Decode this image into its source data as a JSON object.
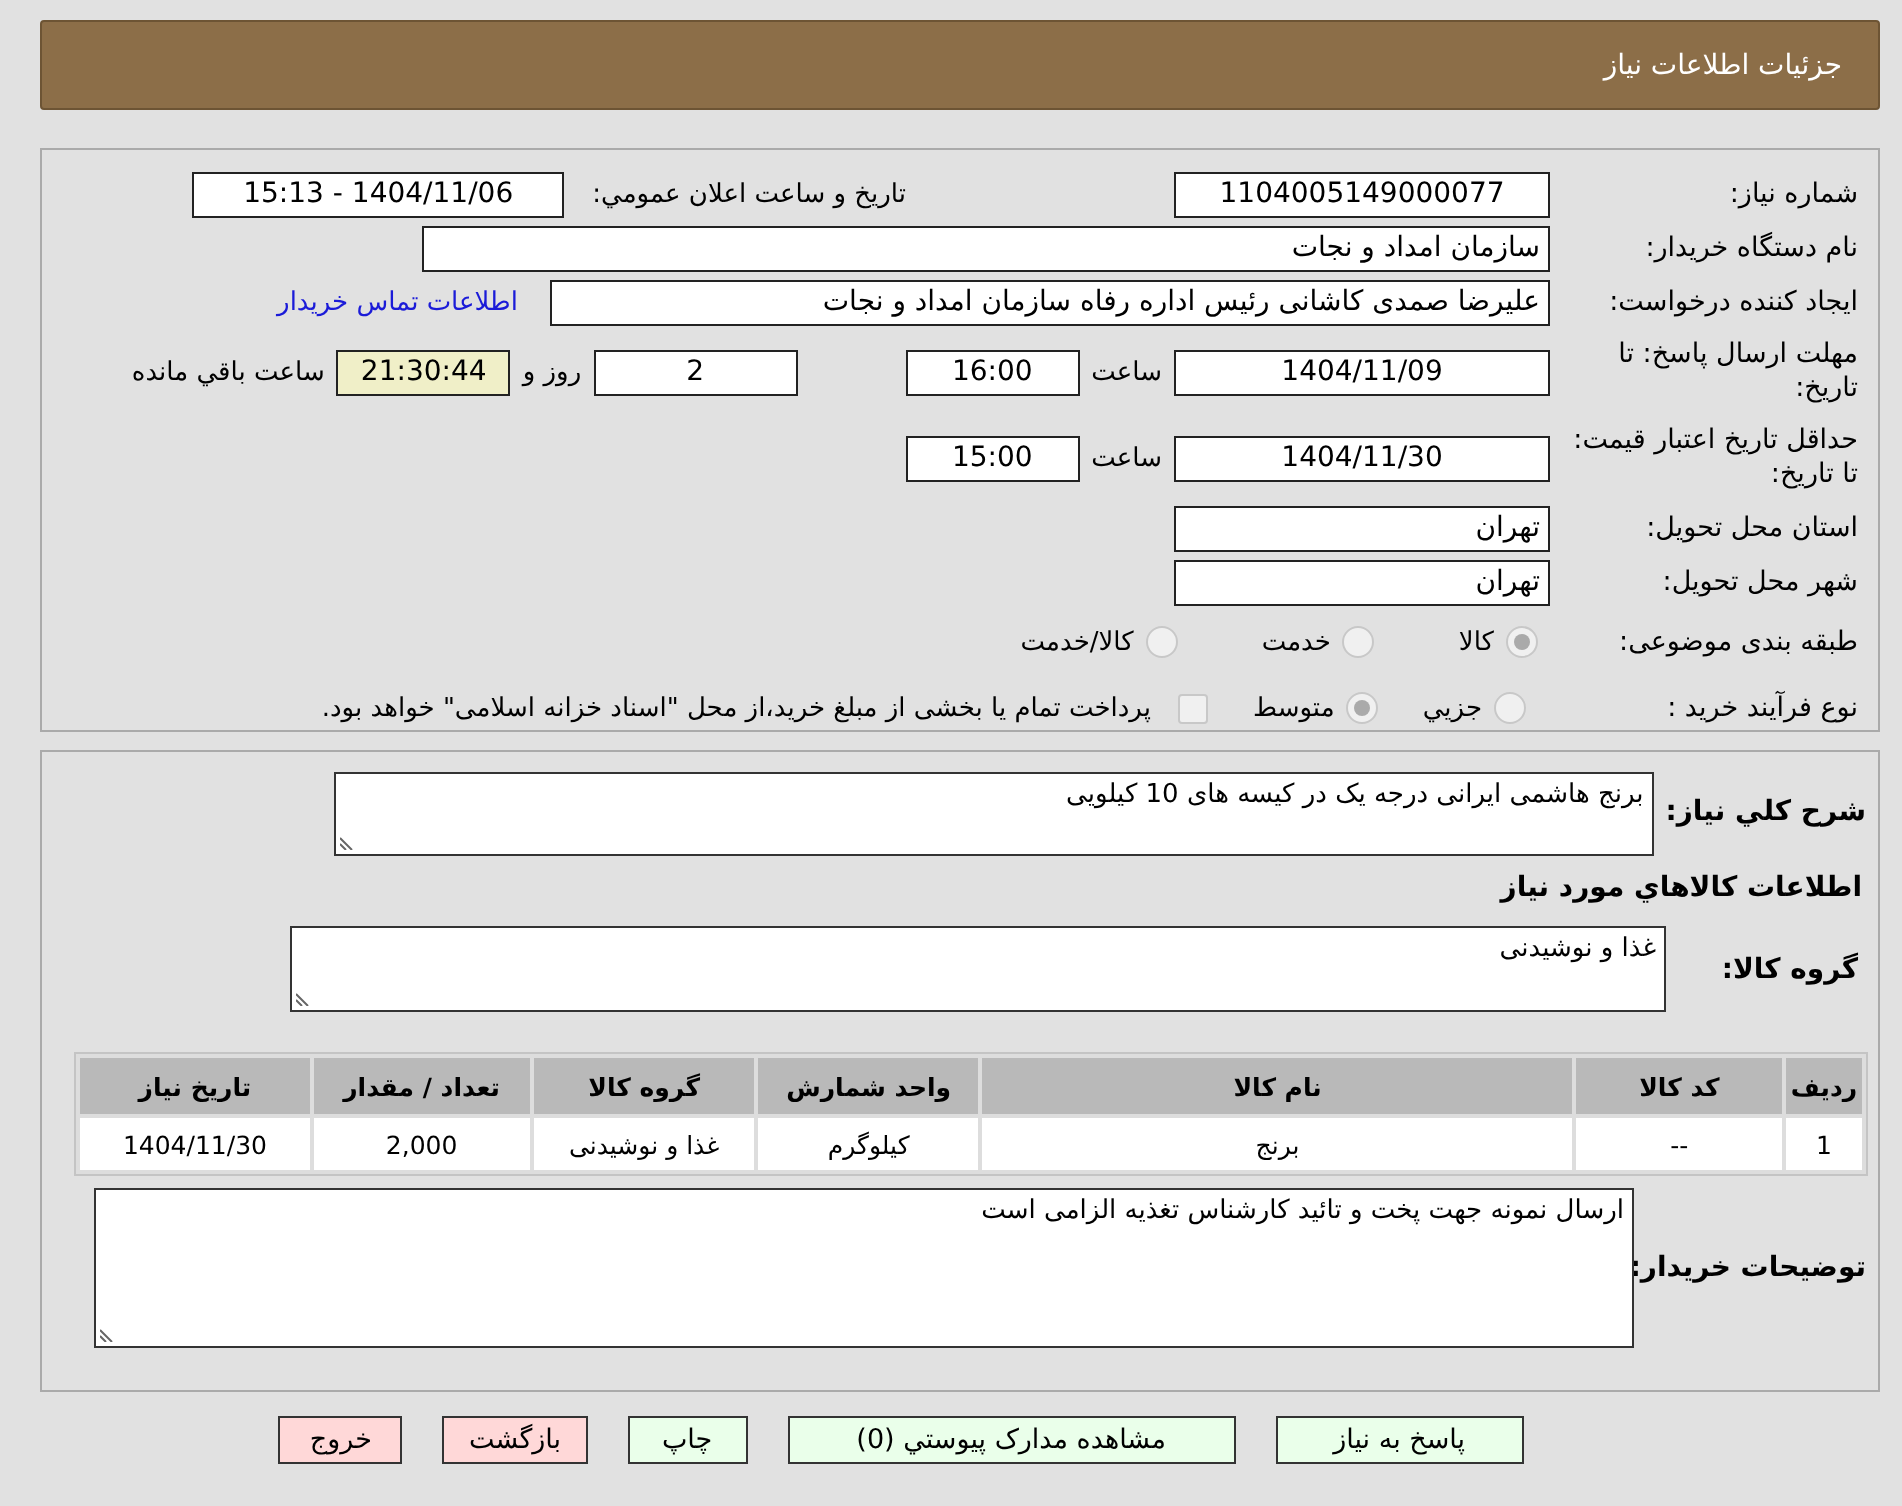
{
  "header": {
    "title": "جزئیات اطلاعات نیاز"
  },
  "details": {
    "need_number": {
      "label": "شماره نیاز:",
      "value": "1104005149000077"
    },
    "announce": {
      "label": "تاریخ و ساعت اعلان عمومي:",
      "value": "1404/11/06 - 15:13"
    },
    "buyer": {
      "label": "نام دستگاه خریدار:",
      "value": "سازمان امداد و نجات"
    },
    "creator": {
      "label": "ایجاد کننده درخواست:",
      "value": "علیرضا صمدی کاشانی رئیس اداره رفاه  سازمان امداد و نجات",
      "link": "اطلاعات تماس خریدار"
    },
    "deadline": {
      "label": "مهلت ارسال پاسخ: تا تاریخ:",
      "date": "1404/11/09",
      "time_label": "ساعت",
      "time": "16:00",
      "days": "2",
      "days_label": "روز و",
      "remaining": "21:30:44",
      "remaining_label": "ساعت باقي مانده"
    },
    "validity": {
      "label": "حداقل تاریخ اعتبار قیمت: تا تاریخ:",
      "date": "1404/11/30",
      "time_label": "ساعت",
      "time": "15:00"
    },
    "province": {
      "label": "استان محل تحویل:",
      "value": "تهران"
    },
    "city": {
      "label": "شهر محل تحویل:",
      "value": "تهران"
    },
    "classification": {
      "label": "طبقه بندی موضوعی:",
      "options": [
        {
          "label": "کالا",
          "selected": true
        },
        {
          "label": "خدمت",
          "selected": false
        },
        {
          "label": "کالا/خدمت",
          "selected": false
        }
      ]
    },
    "process": {
      "label": "نوع فرآیند خرید :",
      "options": [
        {
          "label": "جزيي",
          "selected": false
        },
        {
          "label": "متوسط",
          "selected": true
        }
      ],
      "treasury": {
        "label": "پرداخت تمام یا بخشی از مبلغ خرید،از محل \"اسناد خزانه اسلامی\" خواهد بود.",
        "checked": false
      }
    }
  },
  "description": {
    "label": "شرح کلي نیاز:",
    "value": "برنج هاشمی ایرانی درجه یک در کیسه های 10 کیلویی"
  },
  "items_heading": "اطلاعات کالاهاي مورد نیاز",
  "goods_group": {
    "label": "گروه کالا:",
    "value": "غذا و نوشیدنی"
  },
  "table": {
    "columns": [
      "ردیف",
      "کد کالا",
      "نام کالا",
      "واحد شمارش",
      "گروه کالا",
      "تعداد / مقدار",
      "تاریخ نیاز"
    ],
    "rows": [
      [
        "1",
        "--",
        "برنج",
        "کیلوگرم",
        "غذا و نوشیدنی",
        "2,000",
        "1404/11/30"
      ]
    ]
  },
  "buyer_notes": {
    "label": "توضیحات خریدار:",
    "value": "ارسال نمونه جهت پخت و تائید کارشناس تغذیه الزامی است"
  },
  "buttons": [
    {
      "label": "پاسخ به نیاز",
      "kind": "action"
    },
    {
      "label": "مشاهده مدارک پیوستي (0)",
      "kind": "action"
    },
    {
      "label": "چاپ",
      "kind": "action"
    },
    {
      "label": "بازگشت",
      "kind": "exit"
    },
    {
      "label": "خروج",
      "kind": "exit"
    }
  ]
}
